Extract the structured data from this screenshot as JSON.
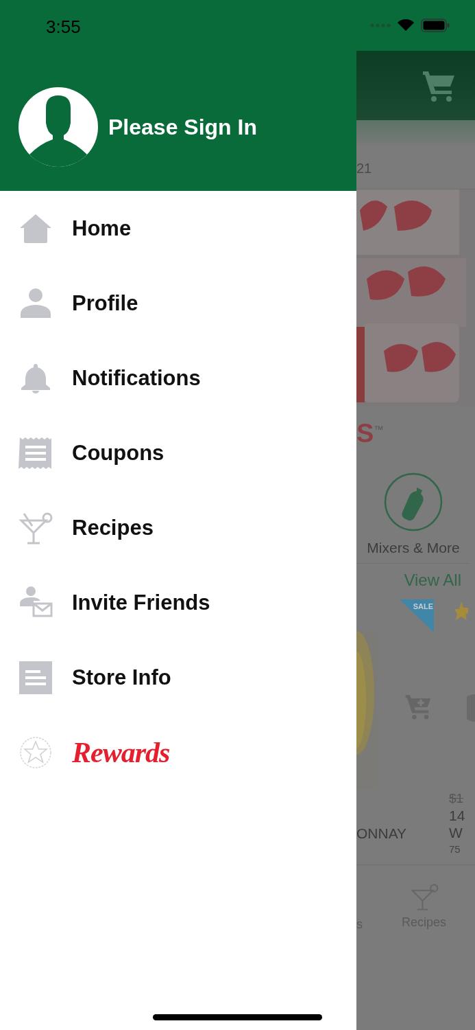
{
  "status_bar": {
    "time": "3:55"
  },
  "drawer": {
    "header": {
      "title": "Please Sign In"
    },
    "items": [
      {
        "kind": "home",
        "label": "Home"
      },
      {
        "kind": "profile",
        "label": "Profile"
      },
      {
        "kind": "notifications",
        "label": "Notifications"
      },
      {
        "kind": "coupons",
        "label": "Coupons"
      },
      {
        "kind": "recipes",
        "label": "Recipes"
      },
      {
        "kind": "invite",
        "label": "Invite Friends"
      },
      {
        "kind": "store",
        "label": "Store Info"
      },
      {
        "kind": "rewards",
        "label": "Rewards"
      }
    ]
  },
  "background": {
    "date_fragment": "21",
    "brand_fragment": "S$^{™}$",
    "category": {
      "label": "Mixers & More"
    },
    "view_all": "View All",
    "sale_badge": "SALE",
    "products": [
      {
        "name": "ONNAY"
      },
      {
        "old_price": "$1",
        "size_line": "14",
        "name": "W",
        "volume": "75"
      }
    ],
    "tabs": [
      {
        "label": "s"
      },
      {
        "label": "Recipes"
      }
    ]
  }
}
